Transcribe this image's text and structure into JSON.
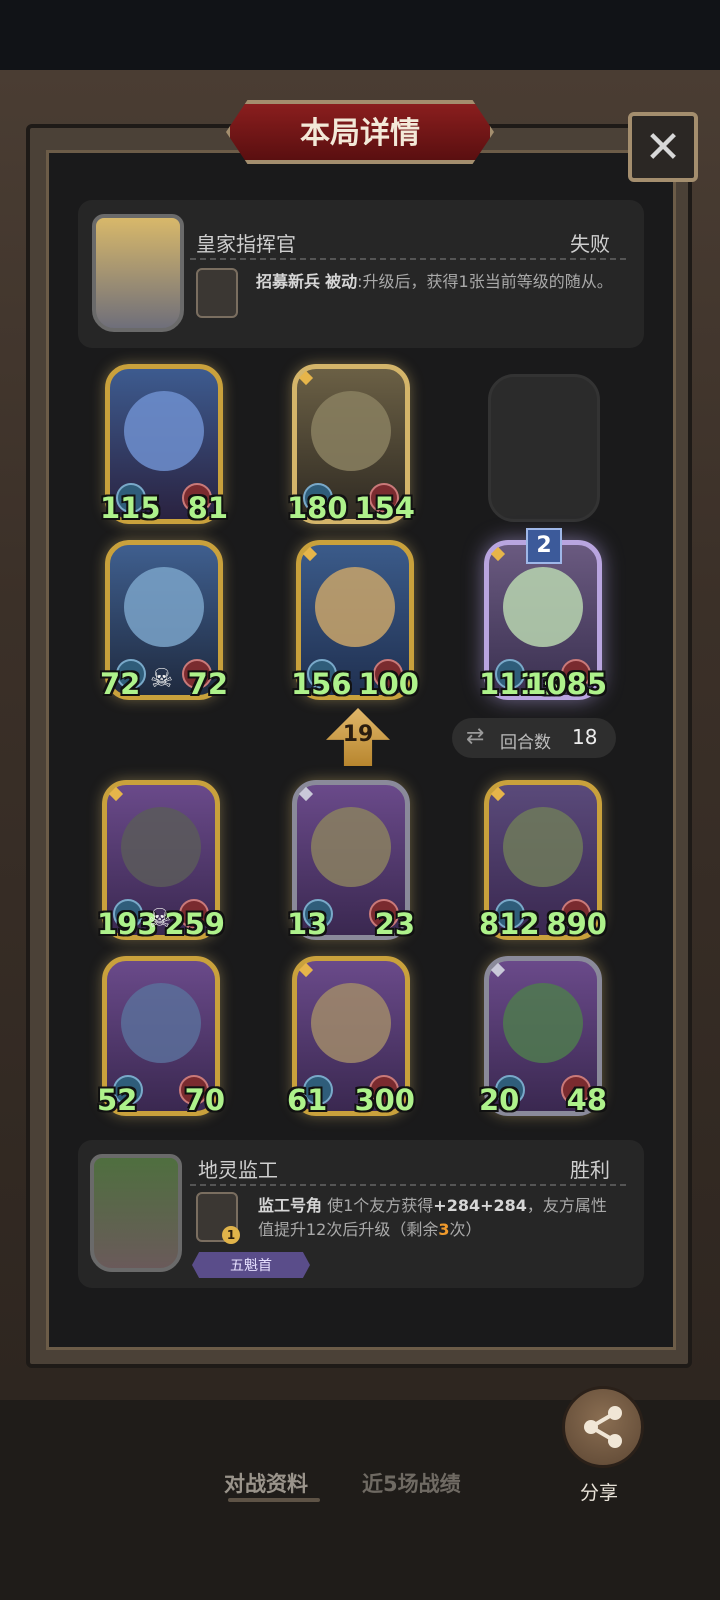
{
  "title": "本局详情",
  "close_icon": "close-icon",
  "top_player": {
    "name": "皇家指挥官",
    "result": "失败",
    "skill_name": "招募新兵",
    "skill_type": "被动",
    "skill_desc": ":升级后，获得1张当前等级的随从。"
  },
  "top_board": [
    {
      "atk": "115",
      "hp": "81"
    },
    {
      "atk": "180",
      "hp": "154"
    },
    {
      "atk": "72",
      "hp": "72"
    },
    {
      "atk": "156",
      "hp": "100"
    },
    {
      "atk": "1113",
      "hp": "1085"
    }
  ],
  "badge_level": "2",
  "round_up": "19",
  "rounds": {
    "label": "回合数",
    "value": "18"
  },
  "bottom_board": [
    {
      "atk": "193",
      "hp": "259"
    },
    {
      "atk": "13",
      "hp": "23"
    },
    {
      "atk": "812",
      "hp": "890"
    },
    {
      "atk": "52",
      "hp": "70"
    },
    {
      "atk": "61",
      "hp": "300"
    },
    {
      "atk": "20",
      "hp": "48"
    }
  ],
  "bottom_player": {
    "name": "地灵监工",
    "result": "胜利",
    "skill_name": "监工号角",
    "skill_desc_1": "使1个友方获得",
    "skill_bonus": "+284+284",
    "skill_desc_2": "，友方属性值提升12次后升级（剩余",
    "skill_remaining": "3",
    "skill_desc_3": "次）",
    "skill_level": "1",
    "tag": "五魁首"
  },
  "tabs": {
    "battle_info": "对战资料",
    "recent": "近5场战绩"
  },
  "share_label": "分享",
  "colors": {
    "stat_green": "#aef28b",
    "gold_frame": "#c9a13c",
    "title_red": "#8a1e1e",
    "highlight_orange": "#f09a2c"
  }
}
